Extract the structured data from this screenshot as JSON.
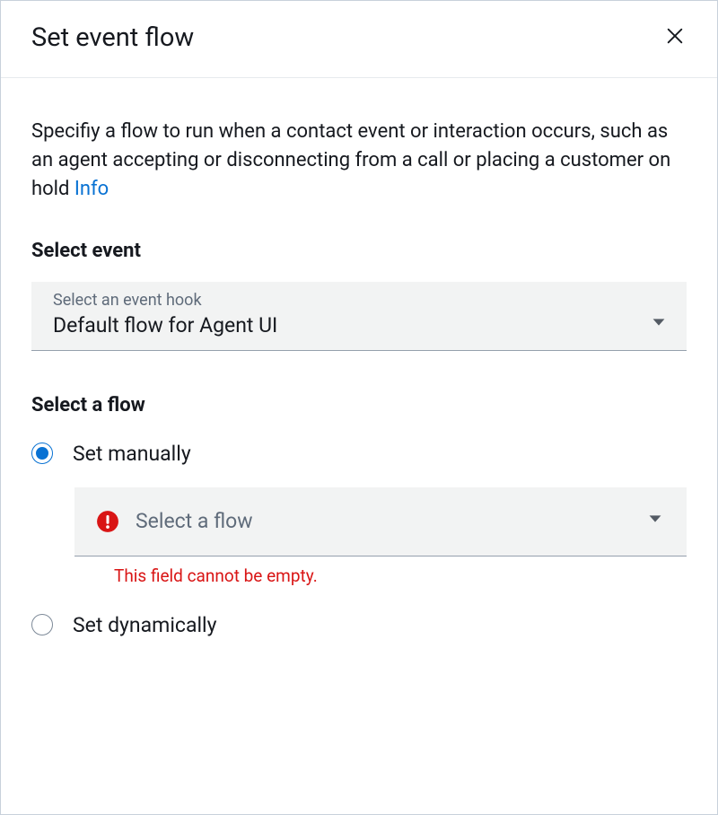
{
  "header": {
    "title": "Set event flow"
  },
  "description": {
    "text": "Specifiy a flow to run when a contact event or interaction occurs, such as an agent accepting or disconnecting from a call or placing a customer on hold ",
    "info_label": "Info"
  },
  "event_section": {
    "label": "Select event",
    "hint": "Select an event hook",
    "value": "Default flow for Agent UI"
  },
  "flow_section": {
    "label": "Select a flow",
    "options": {
      "manual_label": "Set manually",
      "dynamic_label": "Set dynamically"
    },
    "flow_select_placeholder": "Select a flow",
    "error": "This field cannot be empty."
  }
}
